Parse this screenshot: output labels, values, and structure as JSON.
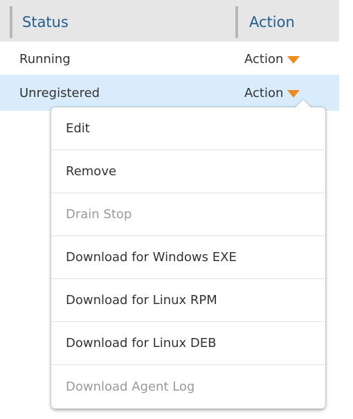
{
  "table": {
    "columns": [
      {
        "label": "Status"
      },
      {
        "label": "Action"
      }
    ],
    "rows": [
      {
        "status": "Running",
        "action_label": "Action",
        "selected": false
      },
      {
        "status": "Unregistered",
        "action_label": "Action",
        "selected": true
      }
    ]
  },
  "action_menu": {
    "items": [
      {
        "label": "Edit",
        "enabled": true
      },
      {
        "label": "Remove",
        "enabled": true
      },
      {
        "label": "Drain Stop",
        "enabled": false
      },
      {
        "label": "Download for Windows EXE",
        "enabled": true
      },
      {
        "label": "Download for Linux RPM",
        "enabled": true
      },
      {
        "label": "Download for Linux DEB",
        "enabled": true
      },
      {
        "label": "Download Agent Log",
        "enabled": false
      }
    ]
  },
  "colors": {
    "header_bg": "#e6e6e6",
    "header_text": "#1f5f92",
    "selected_row_bg": "#d8ecfb",
    "caret": "#f08c1e",
    "disabled_text": "#9a9a9a"
  },
  "icons": {
    "action_caret": "caret-down-icon"
  }
}
